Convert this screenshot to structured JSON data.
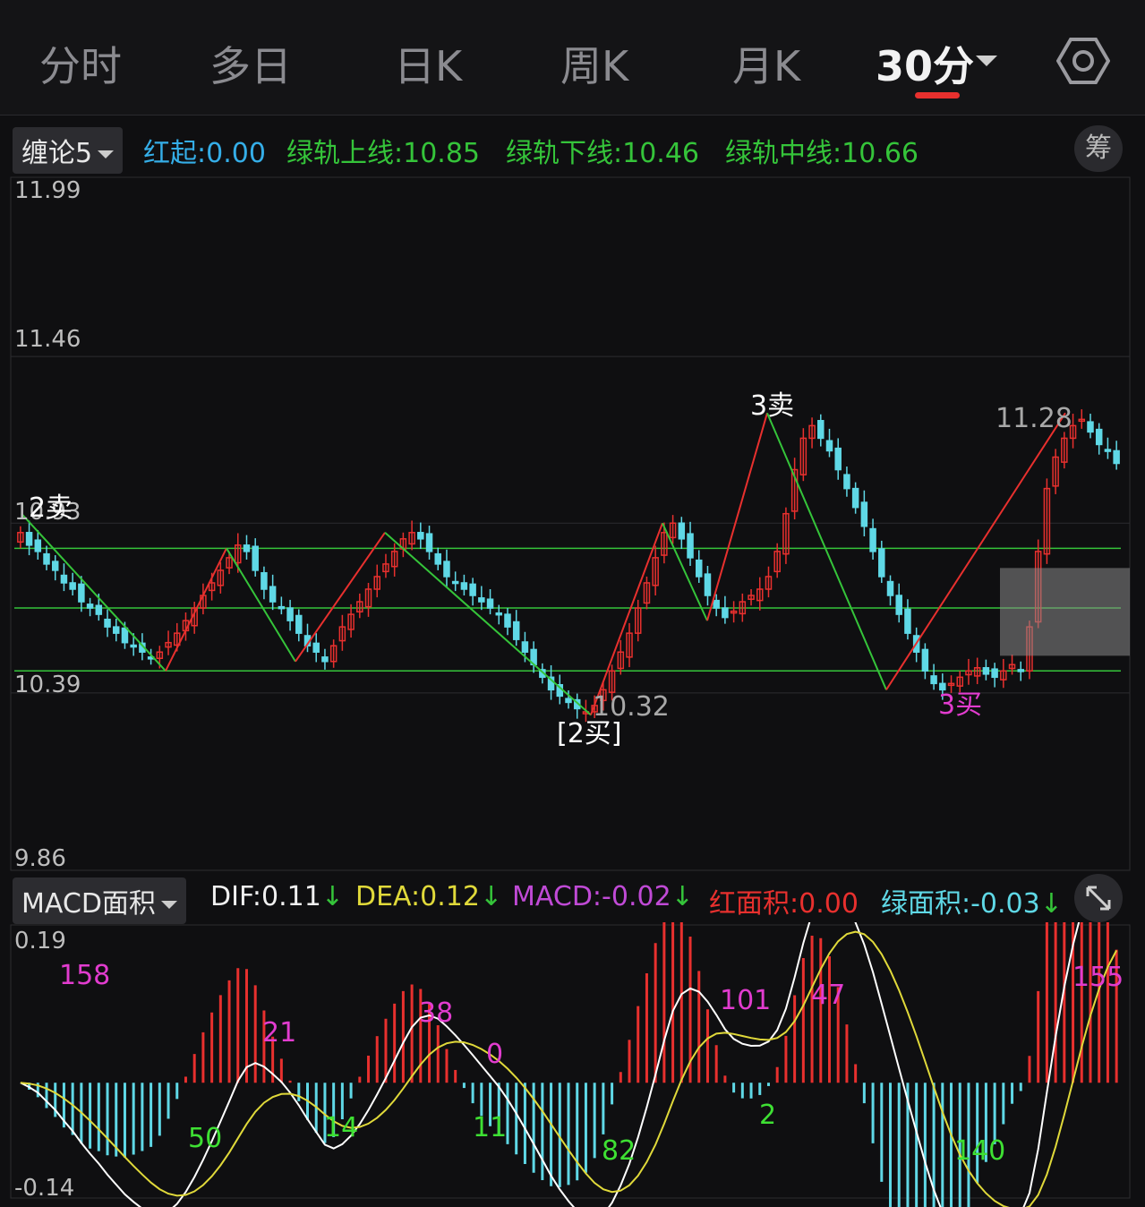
{
  "tabs": [
    {
      "label": "分时"
    },
    {
      "label": "多日"
    },
    {
      "label": "日K"
    },
    {
      "label": "周K"
    },
    {
      "label": "月K"
    },
    {
      "label": "30分"
    }
  ],
  "indicator": {
    "name": "缠论5",
    "items": [
      {
        "label": "红起:",
        "value": "0.00",
        "color": "#35aee8"
      },
      {
        "label": "绿轨上线:",
        "value": "10.85",
        "color": "#35c43a"
      },
      {
        "label": "绿轨下线:",
        "value": "10.46",
        "color": "#35c43a"
      },
      {
        "label": "绿轨中线:",
        "value": "10.66",
        "color": "#35c43a"
      }
    ],
    "side_button": "筹"
  },
  "price_axis": [
    "11.99",
    "11.46",
    "10.93",
    "10.39",
    "9.86"
  ],
  "price_labels": {
    "low": "10.32",
    "high": "11.28"
  },
  "signals": [
    "2卖",
    "[2买]",
    "3卖",
    "3买"
  ],
  "macd": {
    "name": "MACD面积",
    "dif_label": "DIF:",
    "dif": "0.11",
    "dea_label": "DEA:",
    "dea": "0.12",
    "macd_label": "MACD:",
    "macd": "-0.02",
    "red_label": "红面积:",
    "red": "0.00",
    "green_label": "绿面积:",
    "green": "-0.03",
    "arrow": "↓",
    "axis_top": "0.19",
    "axis_bottom": "-0.14",
    "area_labels": [
      "158",
      "50",
      "21",
      "14",
      "38",
      "0",
      "11",
      "82",
      "101",
      "2",
      "47",
      "140",
      "155"
    ]
  },
  "colors": {
    "up": "#e8302e",
    "down": "#5fd8e6",
    "zig_up": "#e8302e",
    "zig_down": "#35c43a",
    "dif": "#ffffff",
    "dea": "#e0d93a",
    "area_red": "#e23ccf",
    "area_green": "#3ee033"
  },
  "chart_data": {
    "type": "candlestick",
    "interval": "30分",
    "ylim": [
      9.86,
      11.99
    ],
    "green_rail": {
      "upper": 10.85,
      "middle": 10.66,
      "lower": 10.46
    },
    "zigzag": [
      {
        "label": "2卖",
        "price": 10.96
      },
      {
        "price": 10.46
      },
      {
        "price": 10.85
      },
      {
        "price": 10.49
      },
      {
        "price": 10.9
      },
      {
        "label": "[2买]",
        "price": 10.32
      },
      {
        "price": 10.93
      },
      {
        "price": 10.62
      },
      {
        "label": "3卖",
        "price": 11.28
      },
      {
        "label": "3买",
        "price": 10.4
      },
      {
        "price": 11.28
      }
    ],
    "closes": [
      10.9,
      10.86,
      10.84,
      10.8,
      10.78,
      10.74,
      10.72,
      10.68,
      10.66,
      10.64,
      10.6,
      10.58,
      10.55,
      10.54,
      10.52,
      10.5,
      10.52,
      10.55,
      10.58,
      10.62,
      10.66,
      10.7,
      10.74,
      10.78,
      10.82,
      10.86,
      10.84,
      10.78,
      10.72,
      10.68,
      10.66,
      10.62,
      10.58,
      10.54,
      10.52,
      10.49,
      10.54,
      10.6,
      10.64,
      10.68,
      10.72,
      10.76,
      10.8,
      10.84,
      10.88,
      10.9,
      10.88,
      10.84,
      10.8,
      10.76,
      10.74,
      10.72,
      10.7,
      10.68,
      10.66,
      10.64,
      10.6,
      10.56,
      10.52,
      10.48,
      10.44,
      10.4,
      10.38,
      10.36,
      10.34,
      10.33,
      10.35,
      10.4,
      10.46,
      10.52,
      10.58,
      10.66,
      10.74,
      10.82,
      10.9,
      10.93,
      10.88,
      10.82,
      10.76,
      10.7,
      10.66,
      10.63,
      10.65,
      10.68,
      10.7,
      10.72,
      10.76,
      10.84,
      10.96,
      11.1,
      11.2,
      11.24,
      11.2,
      11.16,
      11.1,
      11.04,
      10.98,
      10.92,
      10.84,
      10.76,
      10.7,
      10.64,
      10.58,
      10.52,
      10.46,
      10.42,
      10.4,
      10.42,
      10.44,
      10.46,
      10.47,
      10.45,
      10.44,
      10.46,
      10.48,
      10.46,
      10.6,
      10.84,
      11.04,
      11.14,
      11.2,
      11.24,
      11.26,
      11.22,
      11.18,
      11.16,
      11.12
    ],
    "macd_ylim": [
      -0.14,
      0.19
    ]
  }
}
